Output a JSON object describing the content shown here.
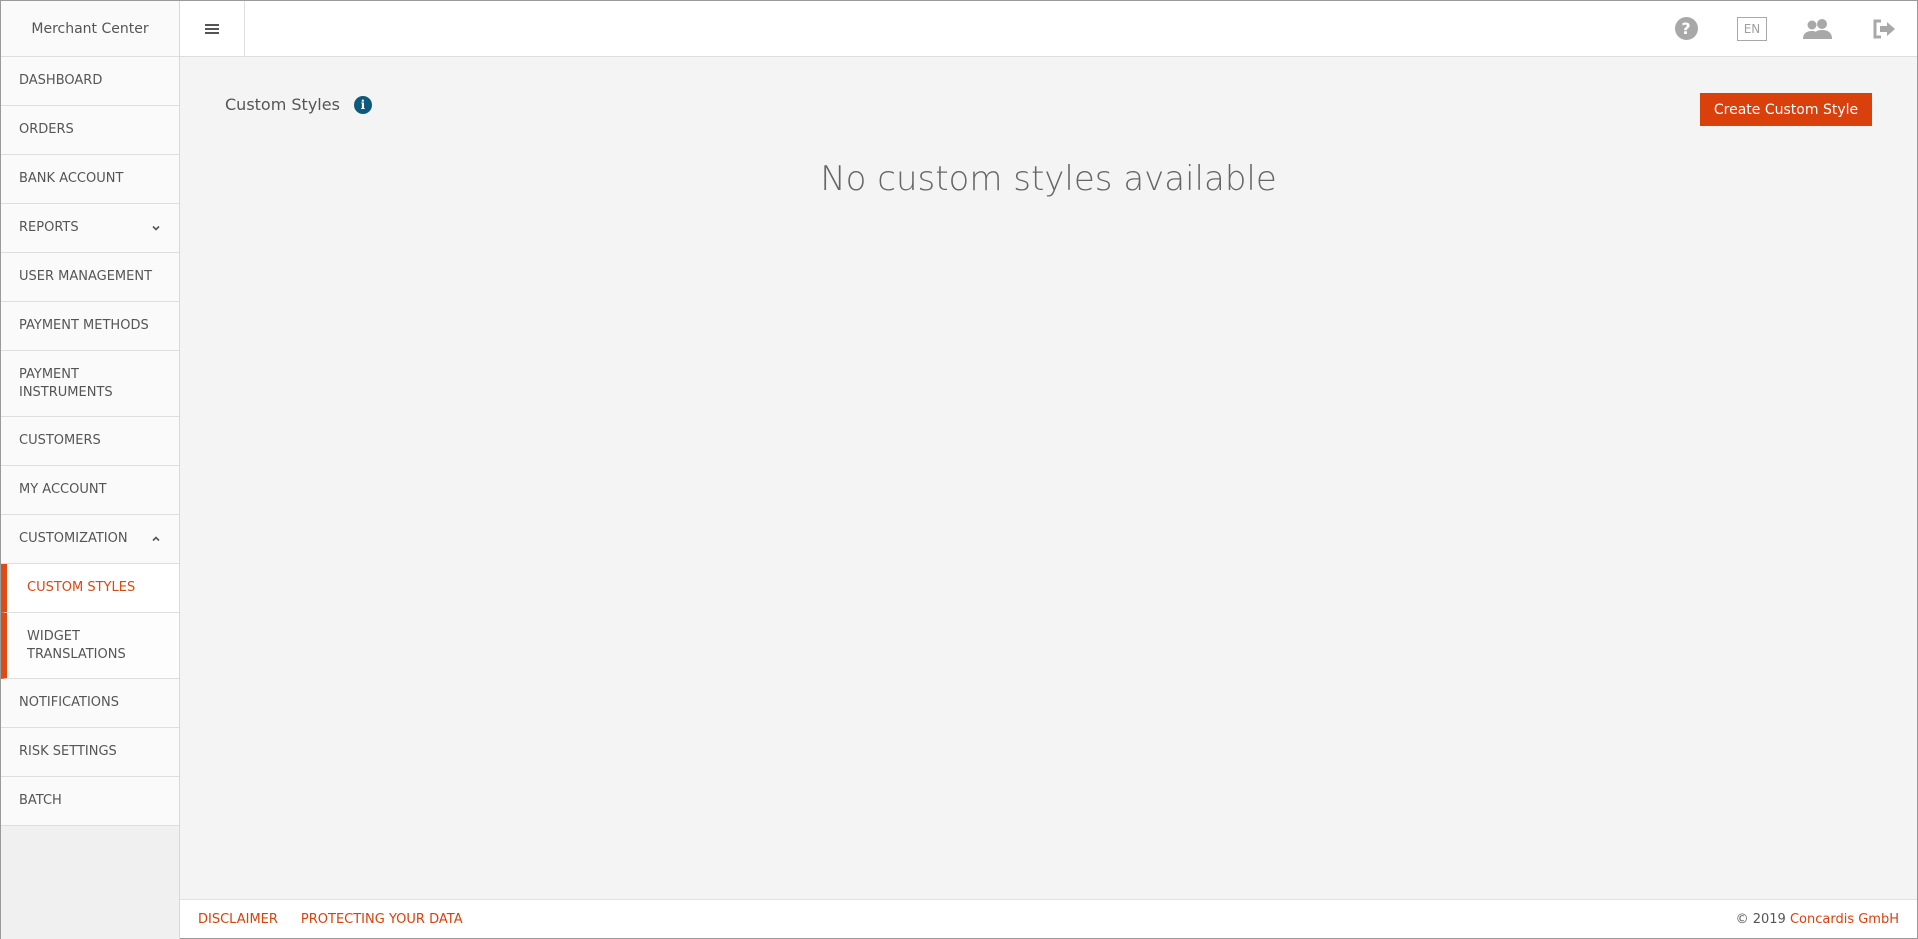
{
  "brand": "Merchant Center",
  "topbar": {
    "menu_icon": "hamburger-icon",
    "lang": "EN",
    "icons": [
      "help-icon",
      "language-icon",
      "users-icon",
      "logout-icon"
    ]
  },
  "sidebar": {
    "items": [
      {
        "label": "DASHBOARD"
      },
      {
        "label": "ORDERS"
      },
      {
        "label": "BANK ACCOUNT"
      },
      {
        "label": "REPORTS"
      },
      {
        "label": "USER MANAGEMENT"
      },
      {
        "label": "PAYMENT METHODS"
      },
      {
        "label": "PAYMENT INSTRUMENTS"
      },
      {
        "label": "CUSTOMERS"
      },
      {
        "label": "MY ACCOUNT"
      },
      {
        "label": "CUSTOMIZATION"
      },
      {
        "label": "CUSTOM STYLES"
      },
      {
        "label": "WIDGET TRANSLATIONS"
      },
      {
        "label": "NOTIFICATIONS"
      },
      {
        "label": "RISK SETTINGS"
      },
      {
        "label": "BATCH"
      }
    ]
  },
  "main": {
    "title": "Custom Styles",
    "create_button": "Create Custom Style",
    "empty_message": "No custom styles available"
  },
  "footer": {
    "disclaimer": "DISCLAIMER",
    "protecting": "PROTECTING YOUR DATA",
    "copyright_prefix": "© 2019 ",
    "copyright_org": "Concardis GmbH"
  },
  "colors": {
    "accent": "#d9400c",
    "info": "#0d5a7a"
  }
}
